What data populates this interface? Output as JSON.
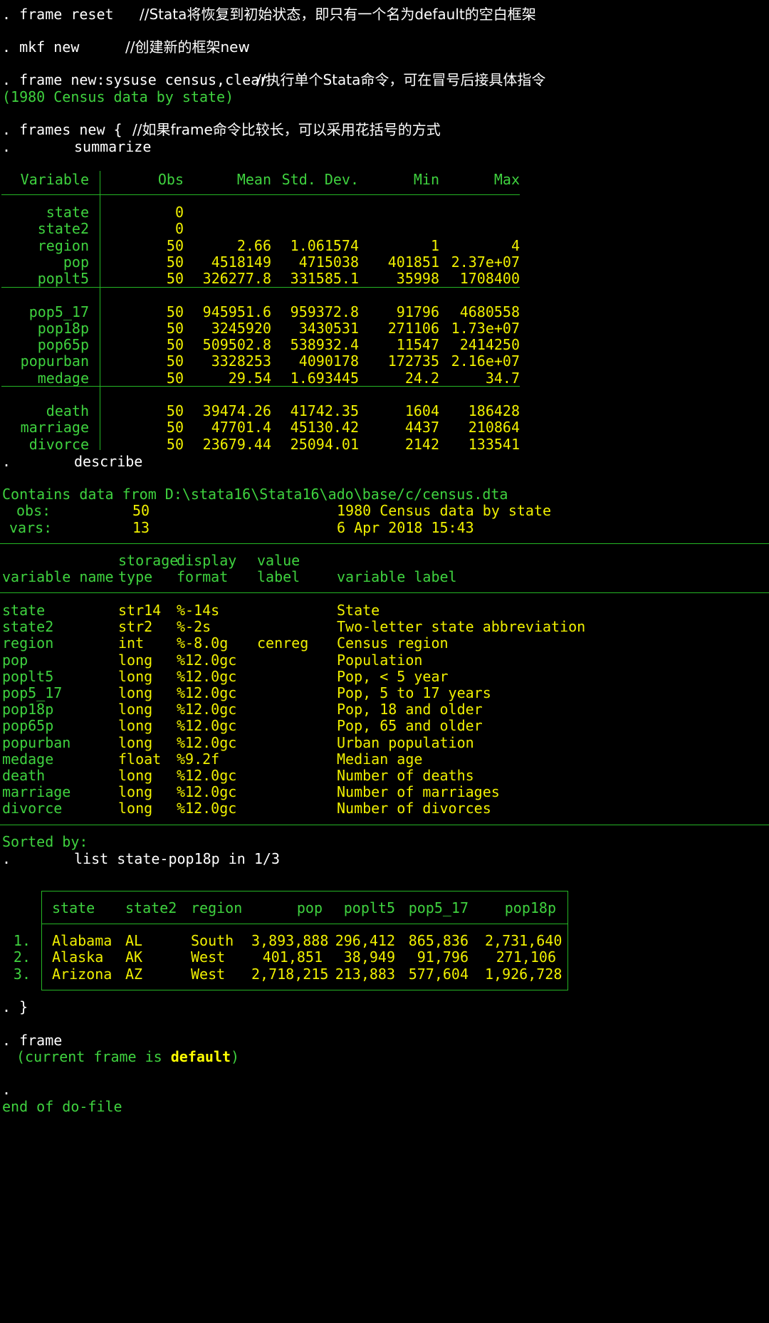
{
  "colors": {
    "background": "#000000",
    "command": "#ffffff",
    "output_text": "#3fd23f",
    "result_value": "#f0f000",
    "rule": "#25b625"
  },
  "commands": [
    {
      "prompt": ".",
      "text": "frame reset",
      "comment": "//Stata将恢复到初始状态，即只有一个名为default的空白框架"
    },
    {
      "prompt": ".",
      "text": "mkf new",
      "comment": "//创建新的框架new"
    },
    {
      "prompt": ".",
      "text": "frame new:sysuse census,clear",
      "comment": "//执行单个Stata命令，可在冒号后接具体指令"
    },
    {
      "prompt": ".",
      "text": "frames new {",
      "comment": "//如果frame命令比较长，可以采用花括号的方式"
    },
    {
      "prompt": ".",
      "text": "summarize"
    },
    {
      "prompt": ".",
      "text": "describe"
    },
    {
      "prompt": ".",
      "text": "list state-pop18p in 1/3"
    },
    {
      "prompt": ".",
      "text": "}"
    },
    {
      "prompt": ".",
      "text": "frame"
    },
    {
      "prompt": ".",
      "text": ""
    }
  ],
  "sysuse_output": "(1980 Census data by state)",
  "summarize": {
    "headers": [
      "Variable",
      "Obs",
      "Mean",
      "Std. Dev.",
      "Min",
      "Max"
    ],
    "groups": [
      [
        [
          "state",
          "0",
          "",
          "",
          "",
          ""
        ],
        [
          "state2",
          "0",
          "",
          "",
          "",
          ""
        ],
        [
          "region",
          "50",
          "2.66",
          "1.061574",
          "1",
          "4"
        ],
        [
          "pop",
          "50",
          "4518149",
          "4715038",
          "401851",
          "2.37e+07"
        ],
        [
          "poplt5",
          "50",
          "326277.8",
          "331585.1",
          "35998",
          "1708400"
        ]
      ],
      [
        [
          "pop5_17",
          "50",
          "945951.6",
          "959372.8",
          "91796",
          "4680558"
        ],
        [
          "pop18p",
          "50",
          "3245920",
          "3430531",
          "271106",
          "1.73e+07"
        ],
        [
          "pop65p",
          "50",
          "509502.8",
          "538932.4",
          "11547",
          "2414250"
        ],
        [
          "popurban",
          "50",
          "3328253",
          "4090178",
          "172735",
          "2.16e+07"
        ],
        [
          "medage",
          "50",
          "29.54",
          "1.693445",
          "24.2",
          "34.7"
        ]
      ],
      [
        [
          "death",
          "50",
          "39474.26",
          "41742.35",
          "1604",
          "186428"
        ],
        [
          "marriage",
          "50",
          "47701.4",
          "45130.42",
          "4437",
          "210864"
        ],
        [
          "divorce",
          "50",
          "23679.44",
          "25094.01",
          "2142",
          "133541"
        ]
      ]
    ]
  },
  "describe": {
    "contains_label": "Contains data from",
    "path": "D:\\stata16\\Stata16\\ado\\base/c/census.dta",
    "obs_label": "obs:",
    "obs_value": "50",
    "dataset_label": "1980 Census data by state",
    "vars_label": "vars:",
    "vars_value": "13",
    "timestamp": "6 Apr 2018 15:43",
    "header_top": [
      "",
      "storage",
      "display",
      "value",
      ""
    ],
    "header_bottom": [
      "variable name",
      "type",
      "format",
      "label",
      "variable label"
    ],
    "rows": [
      [
        "state",
        "str14",
        "%-14s",
        "",
        "State"
      ],
      [
        "state2",
        "str2",
        "%-2s",
        "",
        "Two-letter state abbreviation"
      ],
      [
        "region",
        "int",
        "%-8.0g",
        "cenreg",
        "Census region"
      ],
      [
        "pop",
        "long",
        "%12.0gc",
        "",
        "Population"
      ],
      [
        "poplt5",
        "long",
        "%12.0gc",
        "",
        "Pop, < 5 year"
      ],
      [
        "pop5_17",
        "long",
        "%12.0gc",
        "",
        "Pop, 5 to 17 years"
      ],
      [
        "pop18p",
        "long",
        "%12.0gc",
        "",
        "Pop, 18 and older"
      ],
      [
        "pop65p",
        "long",
        "%12.0gc",
        "",
        "Pop, 65 and older"
      ],
      [
        "popurban",
        "long",
        "%12.0gc",
        "",
        "Urban population"
      ],
      [
        "medage",
        "float",
        "%9.2f",
        "",
        "Median age"
      ],
      [
        "death",
        "long",
        "%12.0gc",
        "",
        "Number of deaths"
      ],
      [
        "marriage",
        "long",
        "%12.0gc",
        "",
        "Number of marriages"
      ],
      [
        "divorce",
        "long",
        "%12.0gc",
        "",
        "Number of divorces"
      ]
    ],
    "sorted_by": "Sorted by:"
  },
  "list": {
    "headers": [
      "state",
      "state2",
      "region",
      "pop",
      "poplt5",
      "pop5_17",
      "pop18p"
    ],
    "rows": [
      [
        "1.",
        "Alabama",
        "AL",
        "South",
        "3,893,888",
        "296,412",
        "865,836",
        "2,731,640"
      ],
      [
        "2.",
        "Alaska",
        "AK",
        "West",
        "401,851",
        "38,949",
        "91,796",
        "271,106"
      ],
      [
        "3.",
        "Arizona",
        "AZ",
        "West",
        "2,718,215",
        "213,883",
        "577,604",
        "1,926,728"
      ]
    ]
  },
  "frame_output": {
    "prefix": "(current frame is ",
    "name": "default",
    "suffix": ")"
  },
  "end_text": "end of do-file"
}
